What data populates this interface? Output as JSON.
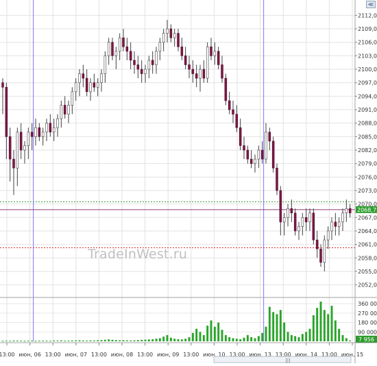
{
  "watermark": "TradeInWest.ru",
  "corner_button": "≪",
  "scroll_grip": "|||",
  "chart_data": {
    "type": "candlestick",
    "price_ticks": [
      "2112,00",
      "2109,00",
      "2106,00",
      "2103,00",
      "2100,00",
      "2097,00",
      "2094,00",
      "2091,00",
      "2088,00",
      "2085,00",
      "2082,00",
      "2079,00",
      "2076,00",
      "2073,00",
      "2070,00",
      "2067,00",
      "2064,00",
      "2061,00",
      "2058,00",
      "2055,00",
      "2052,00"
    ],
    "price_range": [
      2049.5,
      2114.5
    ],
    "last_price": "2068,75",
    "levels": [
      {
        "price": 2070.5,
        "color": "#2e9c2e",
        "style": "dotted"
      },
      {
        "price": 2068.75,
        "color": "#8a3a78",
        "style": "solid"
      },
      {
        "price": 2060.25,
        "color": "#d83030",
        "style": "dotted"
      }
    ],
    "volume_ticks": [
      "360 000",
      "270 000",
      "180 000",
      "90 000"
    ],
    "volume_range": [
      0,
      400000
    ],
    "last_volume": "7 956",
    "time_labels": [
      "13:00",
      "июн, 06",
      "13:00",
      "июн, 07",
      "13:00",
      "июн, 08",
      "13:00",
      "июн, 09",
      "13:00",
      "июн, 10",
      "13:00",
      "июн, 13",
      "13:00",
      "июн, 14",
      "13:00",
      "июн, 15"
    ],
    "session_separators": [
      1,
      11
    ],
    "ohlc": [
      [
        2097,
        2098,
        2090,
        2096
      ],
      [
        2096,
        2097,
        2080,
        2085
      ],
      [
        2085,
        2087,
        2075,
        2080
      ],
      [
        2080,
        2082,
        2072,
        2078
      ],
      [
        2078,
        2087,
        2074,
        2086
      ],
      [
        2086,
        2088,
        2080,
        2082
      ],
      [
        2082,
        2084,
        2079,
        2083
      ],
      [
        2083,
        2087,
        2080,
        2086
      ],
      [
        2086,
        2088,
        2082,
        2085
      ],
      [
        2085,
        2089,
        2083,
        2087
      ],
      [
        2087,
        2088,
        2084,
        2085
      ],
      [
        2085,
        2087,
        2083,
        2086
      ],
      [
        2086,
        2089,
        2084,
        2088
      ],
      [
        2088,
        2090,
        2085,
        2086
      ],
      [
        2086,
        2089,
        2084,
        2087
      ],
      [
        2087,
        2090,
        2085,
        2089
      ],
      [
        2089,
        2093,
        2087,
        2092
      ],
      [
        2092,
        2094,
        2089,
        2090
      ],
      [
        2090,
        2093,
        2088,
        2092
      ],
      [
        2092,
        2096,
        2090,
        2095
      ],
      [
        2095,
        2098,
        2093,
        2097
      ],
      [
        2097,
        2100,
        2094,
        2099
      ],
      [
        2099,
        2101,
        2096,
        2098
      ],
      [
        2098,
        2100,
        2094,
        2095
      ],
      [
        2095,
        2098,
        2093,
        2097
      ],
      [
        2097,
        2099,
        2095,
        2096
      ],
      [
        2096,
        2098,
        2094,
        2097
      ],
      [
        2097,
        2100,
        2095,
        2099
      ],
      [
        2099,
        2104,
        2097,
        2103
      ],
      [
        2103,
        2107,
        2101,
        2106
      ],
      [
        2106,
        2107,
        2102,
        2103
      ],
      [
        2103,
        2105,
        2100,
        2104
      ],
      [
        2104,
        2108,
        2102,
        2107
      ],
      [
        2107,
        2109,
        2104,
        2105
      ],
      [
        2105,
        2107,
        2102,
        2104
      ],
      [
        2104,
        2106,
        2100,
        2102
      ],
      [
        2102,
        2104,
        2099,
        2101
      ],
      [
        2101,
        2103,
        2098,
        2100
      ],
      [
        2100,
        2102,
        2097,
        2099
      ],
      [
        2099,
        2101,
        2097,
        2100
      ],
      [
        2100,
        2103,
        2098,
        2102
      ],
      [
        2102,
        2104,
        2099,
        2101
      ],
      [
        2101,
        2105,
        2099,
        2104
      ],
      [
        2104,
        2107,
        2102,
        2106
      ],
      [
        2106,
        2109,
        2104,
        2108
      ],
      [
        2108,
        2111,
        2106,
        2109
      ],
      [
        2109,
        2110,
        2106,
        2107
      ],
      [
        2107,
        2109,
        2105,
        2108
      ],
      [
        2108,
        2109,
        2104,
        2105
      ],
      [
        2105,
        2107,
        2102,
        2103
      ],
      [
        2103,
        2105,
        2100,
        2101
      ],
      [
        2101,
        2103,
        2098,
        2100
      ],
      [
        2100,
        2102,
        2097,
        2099
      ],
      [
        2099,
        2101,
        2096,
        2098
      ],
      [
        2098,
        2101,
        2095,
        2100
      ],
      [
        2100,
        2102,
        2097,
        2098
      ],
      [
        2098,
        2106,
        2097,
        2105
      ],
      [
        2105,
        2107,
        2102,
        2103
      ],
      [
        2103,
        2106,
        2101,
        2104
      ],
      [
        2104,
        2105,
        2100,
        2101
      ],
      [
        2101,
        2103,
        2097,
        2098
      ],
      [
        2098,
        2099,
        2092,
        2093
      ],
      [
        2093,
        2095,
        2090,
        2091
      ],
      [
        2091,
        2093,
        2088,
        2090
      ],
      [
        2090,
        2092,
        2086,
        2087
      ],
      [
        2087,
        2089,
        2082,
        2083
      ],
      [
        2083,
        2085,
        2080,
        2082
      ],
      [
        2082,
        2083,
        2079,
        2080
      ],
      [
        2080,
        2082,
        2078,
        2079
      ],
      [
        2079,
        2081,
        2077,
        2080
      ],
      [
        2080,
        2083,
        2078,
        2082
      ],
      [
        2082,
        2084,
        2079,
        2080
      ],
      [
        2080,
        2088,
        2079,
        2086
      ],
      [
        2086,
        2087,
        2082,
        2084
      ],
      [
        2084,
        2085,
        2077,
        2078
      ],
      [
        2078,
        2079,
        2072,
        2073
      ],
      [
        2073,
        2074,
        2063,
        2066
      ],
      [
        2066,
        2068,
        2063,
        2067
      ],
      [
        2067,
        2070,
        2065,
        2069
      ],
      [
        2069,
        2071,
        2066,
        2068
      ],
      [
        2068,
        2069,
        2063,
        2064
      ],
      [
        2064,
        2066,
        2062,
        2065
      ],
      [
        2065,
        2068,
        2063,
        2067
      ],
      [
        2067,
        2069,
        2064,
        2066
      ],
      [
        2066,
        2069,
        2064,
        2068
      ],
      [
        2068,
        2069,
        2061,
        2062
      ],
      [
        2062,
        2064,
        2058,
        2060
      ],
      [
        2060,
        2061,
        2056,
        2057
      ],
      [
        2057,
        2063,
        2055,
        2062
      ],
      [
        2062,
        2065,
        2060,
        2064
      ],
      [
        2064,
        2067,
        2062,
        2066
      ],
      [
        2066,
        2068,
        2063,
        2065
      ],
      [
        2065,
        2067,
        2063,
        2066
      ],
      [
        2066,
        2069,
        2064,
        2068
      ],
      [
        2068,
        2071,
        2066,
        2069
      ],
      [
        2069,
        2070,
        2067,
        2068
      ]
    ],
    "volume": [
      5000,
      6000,
      5000,
      8000,
      7000,
      6000,
      5000,
      6000,
      7000,
      5000,
      6000,
      7000,
      6000,
      5000,
      8000,
      7000,
      9000,
      6000,
      7000,
      8000,
      9000,
      10000,
      8000,
      7000,
      9000,
      8000,
      10000,
      12000,
      15000,
      18000,
      14000,
      12000,
      10000,
      11000,
      9000,
      8000,
      10000,
      12000,
      14000,
      16000,
      18000,
      20000,
      25000,
      30000,
      45000,
      60000,
      35000,
      25000,
      20000,
      18000,
      25000,
      40000,
      80000,
      120000,
      90000,
      60000,
      150000,
      200000,
      140000,
      180000,
      110000,
      60000,
      40000,
      30000,
      25000,
      20000,
      35000,
      60000,
      40000,
      30000,
      50000,
      80000,
      140000,
      330000,
      280000,
      260000,
      300000,
      180000,
      90000,
      60000,
      50000,
      40000,
      70000,
      90000,
      120000,
      250000,
      320000,
      380000,
      300000,
      260000,
      340000,
      200000,
      120000,
      60000,
      30000,
      7956
    ]
  }
}
